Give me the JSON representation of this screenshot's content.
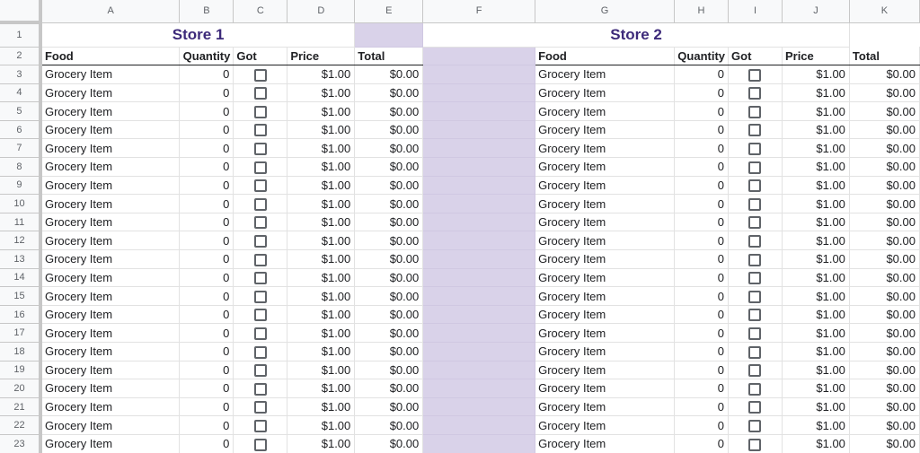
{
  "columns": [
    "A",
    "B",
    "C",
    "D",
    "E",
    "F",
    "G",
    "H",
    "I",
    "J",
    "K"
  ],
  "row_numbers": [
    "1",
    "2",
    "3",
    "4",
    "5",
    "6",
    "7",
    "8",
    "9",
    "10",
    "11",
    "12",
    "13",
    "14",
    "15",
    "16",
    "17",
    "18",
    "19",
    "20",
    "21",
    "22",
    "23"
  ],
  "stores": [
    {
      "title": "Store 1",
      "headers": {
        "food": "Food",
        "quantity": "Quantity",
        "got": "Got",
        "price": "Price",
        "total": "Total"
      }
    },
    {
      "title": "Store 2",
      "headers": {
        "food": "Food",
        "quantity": "Quantity",
        "got": "Got",
        "price": "Price",
        "total": "Total"
      }
    }
  ],
  "rows": [
    {
      "s1": {
        "food": "Grocery Item",
        "quantity": "0",
        "got": false,
        "price": "$1.00",
        "total": "$0.00"
      },
      "s2": {
        "food": "Grocery Item",
        "quantity": "0",
        "got": false,
        "price": "$1.00",
        "total": "$0.00"
      }
    },
    {
      "s1": {
        "food": "Grocery Item",
        "quantity": "0",
        "got": false,
        "price": "$1.00",
        "total": "$0.00"
      },
      "s2": {
        "food": "Grocery Item",
        "quantity": "0",
        "got": false,
        "price": "$1.00",
        "total": "$0.00"
      }
    },
    {
      "s1": {
        "food": "Grocery Item",
        "quantity": "0",
        "got": false,
        "price": "$1.00",
        "total": "$0.00"
      },
      "s2": {
        "food": "Grocery Item",
        "quantity": "0",
        "got": false,
        "price": "$1.00",
        "total": "$0.00"
      }
    },
    {
      "s1": {
        "food": "Grocery Item",
        "quantity": "0",
        "got": false,
        "price": "$1.00",
        "total": "$0.00"
      },
      "s2": {
        "food": "Grocery Item",
        "quantity": "0",
        "got": false,
        "price": "$1.00",
        "total": "$0.00"
      }
    },
    {
      "s1": {
        "food": "Grocery Item",
        "quantity": "0",
        "got": false,
        "price": "$1.00",
        "total": "$0.00"
      },
      "s2": {
        "food": "Grocery Item",
        "quantity": "0",
        "got": false,
        "price": "$1.00",
        "total": "$0.00"
      }
    },
    {
      "s1": {
        "food": "Grocery Item",
        "quantity": "0",
        "got": false,
        "price": "$1.00",
        "total": "$0.00"
      },
      "s2": {
        "food": "Grocery Item",
        "quantity": "0",
        "got": false,
        "price": "$1.00",
        "total": "$0.00"
      }
    },
    {
      "s1": {
        "food": "Grocery Item",
        "quantity": "0",
        "got": false,
        "price": "$1.00",
        "total": "$0.00"
      },
      "s2": {
        "food": "Grocery Item",
        "quantity": "0",
        "got": false,
        "price": "$1.00",
        "total": "$0.00"
      }
    },
    {
      "s1": {
        "food": "Grocery Item",
        "quantity": "0",
        "got": false,
        "price": "$1.00",
        "total": "$0.00"
      },
      "s2": {
        "food": "Grocery Item",
        "quantity": "0",
        "got": false,
        "price": "$1.00",
        "total": "$0.00"
      }
    },
    {
      "s1": {
        "food": "Grocery Item",
        "quantity": "0",
        "got": false,
        "price": "$1.00",
        "total": "$0.00"
      },
      "s2": {
        "food": "Grocery Item",
        "quantity": "0",
        "got": false,
        "price": "$1.00",
        "total": "$0.00"
      }
    },
    {
      "s1": {
        "food": "Grocery Item",
        "quantity": "0",
        "got": false,
        "price": "$1.00",
        "total": "$0.00"
      },
      "s2": {
        "food": "Grocery Item",
        "quantity": "0",
        "got": false,
        "price": "$1.00",
        "total": "$0.00"
      }
    },
    {
      "s1": {
        "food": "Grocery Item",
        "quantity": "0",
        "got": false,
        "price": "$1.00",
        "total": "$0.00"
      },
      "s2": {
        "food": "Grocery Item",
        "quantity": "0",
        "got": false,
        "price": "$1.00",
        "total": "$0.00"
      }
    },
    {
      "s1": {
        "food": "Grocery Item",
        "quantity": "0",
        "got": false,
        "price": "$1.00",
        "total": "$0.00"
      },
      "s2": {
        "food": "Grocery Item",
        "quantity": "0",
        "got": false,
        "price": "$1.00",
        "total": "$0.00"
      }
    },
    {
      "s1": {
        "food": "Grocery Item",
        "quantity": "0",
        "got": false,
        "price": "$1.00",
        "total": "$0.00"
      },
      "s2": {
        "food": "Grocery Item",
        "quantity": "0",
        "got": false,
        "price": "$1.00",
        "total": "$0.00"
      }
    },
    {
      "s1": {
        "food": "Grocery Item",
        "quantity": "0",
        "got": false,
        "price": "$1.00",
        "total": "$0.00"
      },
      "s2": {
        "food": "Grocery Item",
        "quantity": "0",
        "got": false,
        "price": "$1.00",
        "total": "$0.00"
      }
    },
    {
      "s1": {
        "food": "Grocery Item",
        "quantity": "0",
        "got": false,
        "price": "$1.00",
        "total": "$0.00"
      },
      "s2": {
        "food": "Grocery Item",
        "quantity": "0",
        "got": false,
        "price": "$1.00",
        "total": "$0.00"
      }
    },
    {
      "s1": {
        "food": "Grocery Item",
        "quantity": "0",
        "got": false,
        "price": "$1.00",
        "total": "$0.00"
      },
      "s2": {
        "food": "Grocery Item",
        "quantity": "0",
        "got": false,
        "price": "$1.00",
        "total": "$0.00"
      }
    },
    {
      "s1": {
        "food": "Grocery Item",
        "quantity": "0",
        "got": false,
        "price": "$1.00",
        "total": "$0.00"
      },
      "s2": {
        "food": "Grocery Item",
        "quantity": "0",
        "got": false,
        "price": "$1.00",
        "total": "$0.00"
      }
    },
    {
      "s1": {
        "food": "Grocery Item",
        "quantity": "0",
        "got": false,
        "price": "$1.00",
        "total": "$0.00"
      },
      "s2": {
        "food": "Grocery Item",
        "quantity": "0",
        "got": false,
        "price": "$1.00",
        "total": "$0.00"
      }
    },
    {
      "s1": {
        "food": "Grocery Item",
        "quantity": "0",
        "got": false,
        "price": "$1.00",
        "total": "$0.00"
      },
      "s2": {
        "food": "Grocery Item",
        "quantity": "0",
        "got": false,
        "price": "$1.00",
        "total": "$0.00"
      }
    },
    {
      "s1": {
        "food": "Grocery Item",
        "quantity": "0",
        "got": false,
        "price": "$1.00",
        "total": "$0.00"
      },
      "s2": {
        "food": "Grocery Item",
        "quantity": "0",
        "got": false,
        "price": "$1.00",
        "total": "$0.00"
      }
    },
    {
      "s1": {
        "food": "Grocery Item",
        "quantity": "0",
        "got": false,
        "price": "$1.00",
        "total": "$0.00"
      },
      "s2": {
        "food": "Grocery Item",
        "quantity": "0",
        "got": false,
        "price": "$1.00",
        "total": "$0.00"
      }
    }
  ],
  "colors": {
    "title": "#3d2a7a",
    "separator": "#d9d2e9"
  }
}
